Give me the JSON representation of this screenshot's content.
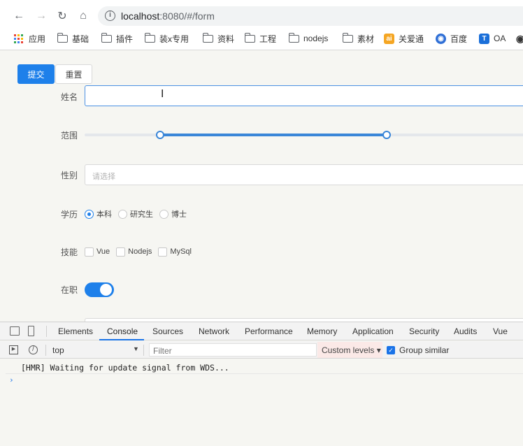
{
  "browser": {
    "url_host": "localhost",
    "url_rest": ":8080/#/form",
    "bookmarks": [
      "应用",
      "基础",
      "插件",
      "装x专用",
      "资料",
      "工程",
      "nodejs",
      "素材",
      "关爱通",
      "百度",
      "OA"
    ]
  },
  "form": {
    "submit_label": "提交",
    "reset_label": "重置",
    "name_label": "姓名",
    "range_label": "范围",
    "range_value": [
      20,
      70
    ],
    "gender_label": "性别",
    "gender_placeholder": "请选择",
    "education_label": "学历",
    "education_options": [
      "本科",
      "研究生",
      "博士"
    ],
    "education_selected": "本科",
    "skills_label": "技能",
    "skills_options": [
      "Vue",
      "Nodejs",
      "MySql"
    ],
    "employed_label": "在职",
    "employed": true
  },
  "devtools": {
    "tabs": [
      "Elements",
      "Console",
      "Sources",
      "Network",
      "Performance",
      "Memory",
      "Application",
      "Security",
      "Audits",
      "Vue"
    ],
    "active_tab": "Console",
    "context": "top",
    "filter_placeholder": "Filter",
    "levels_label": "Custom levels ▾",
    "group_similar_label": "Group similar",
    "console_message": "[HMR] Waiting for update signal from WDS...",
    "prompt": "›"
  },
  "colors": {
    "primary": "#1e80ea",
    "devtools_accent": "#1a73e8"
  }
}
